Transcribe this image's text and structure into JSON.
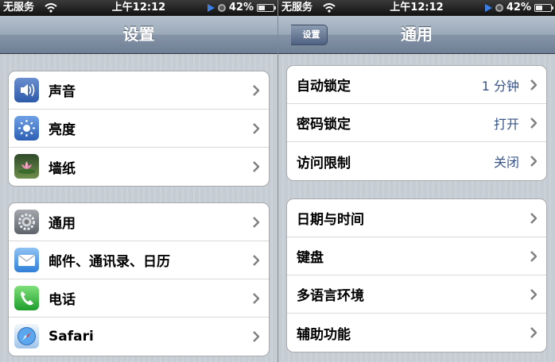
{
  "status_bar": {
    "carrier": "无服务",
    "time": "上午12:12",
    "battery": "42%",
    "battery_level": 0.42
  },
  "left_screen": {
    "title": "设置",
    "groups": [
      {
        "items": [
          {
            "label": "声音",
            "icon": "sound-icon"
          },
          {
            "label": "亮度",
            "icon": "brightness-icon"
          },
          {
            "label": "墙纸",
            "icon": "wallpaper-icon"
          }
        ]
      },
      {
        "items": [
          {
            "label": "通用",
            "icon": "general-gear-icon"
          },
          {
            "label": "邮件、通讯录、日历",
            "icon": "mail-icon"
          },
          {
            "label": "电话",
            "icon": "phone-icon"
          },
          {
            "label": "Safari",
            "icon": "safari-icon"
          }
        ]
      }
    ]
  },
  "right_screen": {
    "back_label": "设置",
    "title": "通用",
    "groups": [
      {
        "items": [
          {
            "label": "自动锁定",
            "value": "1 分钟"
          },
          {
            "label": "密码锁定",
            "value": "打开"
          },
          {
            "label": "访问限制",
            "value": "关闭"
          }
        ]
      },
      {
        "items": [
          {
            "label": "日期与时间"
          },
          {
            "label": "键盘"
          },
          {
            "label": "多语言环境"
          },
          {
            "label": "辅助功能"
          }
        ]
      }
    ]
  },
  "colors": {
    "nav_bar": "#8694a7",
    "value_text": "#385487",
    "background": "#c5ccd4"
  }
}
